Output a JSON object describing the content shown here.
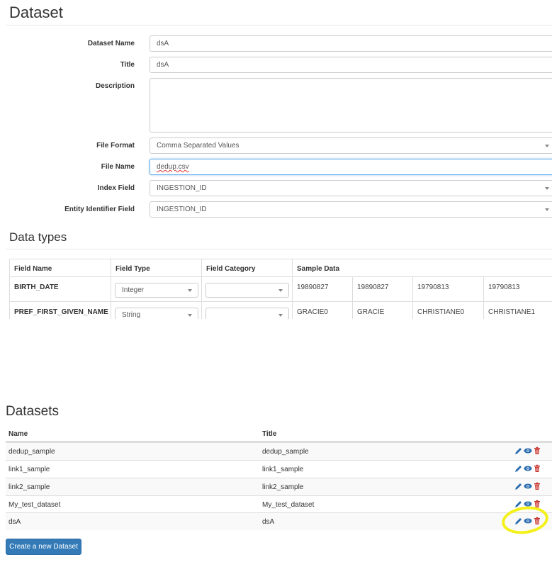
{
  "headings": {
    "dataset": "Dataset",
    "data_types": "Data types",
    "datasets": "Datasets"
  },
  "form": {
    "dataset_name": {
      "label": "Dataset Name",
      "value": "dsA"
    },
    "title": {
      "label": "Title",
      "value": "dsA"
    },
    "description": {
      "label": "Description",
      "value": ""
    },
    "file_format": {
      "label": "File Format",
      "value": "Comma Separated Values"
    },
    "file_name": {
      "label": "File Name",
      "value": "dedup.csv"
    },
    "index_field": {
      "label": "Index Field",
      "value": "INGESTION_ID"
    },
    "entity_identifier_field": {
      "label": "Entity Identifier Field",
      "value": "INGESTION_ID"
    }
  },
  "data_types": {
    "headers": [
      "Field Name",
      "Field Type",
      "Field Category",
      "Sample Data"
    ],
    "rows": [
      {
        "field_name": "BIRTH_DATE",
        "field_type": "Integer",
        "field_category": "",
        "samples": [
          "19890827",
          "19890827",
          "19790813",
          "19790813"
        ]
      },
      {
        "field_name": "PREF_FIRST_GIVEN_NAME",
        "field_type": "String",
        "field_category": "",
        "samples": [
          "GRACIE0",
          "GRACIE",
          "CHRISTIANE0",
          "CHRISTIANE1"
        ]
      }
    ]
  },
  "datasets_table": {
    "headers": [
      "Name",
      "Title"
    ],
    "rows": [
      {
        "name": "dedup_sample",
        "title": "dedup_sample"
      },
      {
        "name": "link1_sample",
        "title": "link1_sample"
      },
      {
        "name": "link2_sample",
        "title": "link2_sample"
      },
      {
        "name": "My_test_dataset",
        "title": "My_test_dataset"
      },
      {
        "name": "dsA",
        "title": "dsA"
      }
    ]
  },
  "actions": {
    "create_button": "Create a new Dataset"
  },
  "icons": {
    "edit": "pencil-icon",
    "view": "eye-icon",
    "delete": "trash-icon",
    "select": "chevron-down-icon"
  },
  "colors": {
    "primary": "#337ab7",
    "edit_icon": "#2b6cb0",
    "view_icon": "#2b6cb0",
    "delete_icon": "#c9302c",
    "highlight": "#f4f01a"
  }
}
